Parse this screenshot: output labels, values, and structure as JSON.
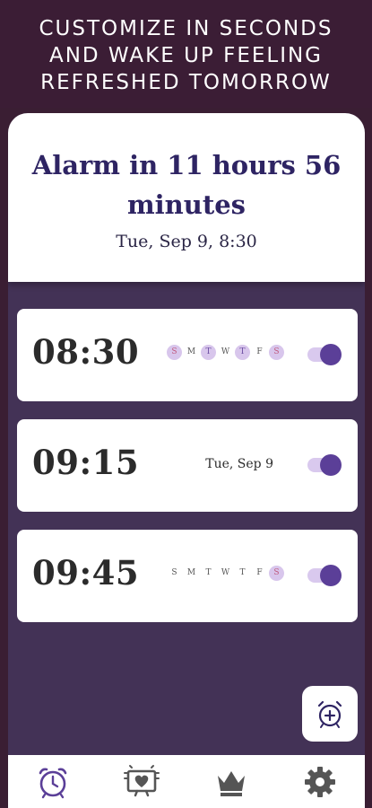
{
  "promo": {
    "line1": "CUSTOMIZE IN SECONDS",
    "line2": "AND WAKE UP FEELING",
    "line3": "REFRESHED TOMORROW"
  },
  "header": {
    "title": "Alarm in 11 hours 56 minutes",
    "next_alarm": "Tue, Sep 9, 8:30"
  },
  "alarms": [
    {
      "time": "08:30",
      "enabled": true,
      "days": [
        {
          "letter": "S",
          "active": true
        },
        {
          "letter": "M",
          "active": false
        },
        {
          "letter": "T",
          "active": true
        },
        {
          "letter": "W",
          "active": false
        },
        {
          "letter": "T",
          "active": true
        },
        {
          "letter": "F",
          "active": false
        },
        {
          "letter": "S",
          "active": true
        }
      ]
    },
    {
      "time": "09:15",
      "enabled": true,
      "date": "Tue, Sep 9"
    },
    {
      "time": "09:45",
      "enabled": true,
      "days": [
        {
          "letter": "S",
          "active": false
        },
        {
          "letter": "M",
          "active": false
        },
        {
          "letter": "T",
          "active": false
        },
        {
          "letter": "W",
          "active": false
        },
        {
          "letter": "T",
          "active": false
        },
        {
          "letter": "F",
          "active": false
        },
        {
          "letter": "S",
          "active": true
        }
      ]
    }
  ],
  "nav": {
    "items": [
      {
        "icon": "alarm-clock-icon",
        "active": true
      },
      {
        "icon": "sleep-heart-icon",
        "active": false
      },
      {
        "icon": "crown-icon",
        "active": false
      },
      {
        "icon": "gear-icon",
        "active": false
      }
    ]
  },
  "colors": {
    "accent": "#5b3f98",
    "title": "#2e2463",
    "background": "#433256",
    "promo_bg": "#3b1d35"
  }
}
